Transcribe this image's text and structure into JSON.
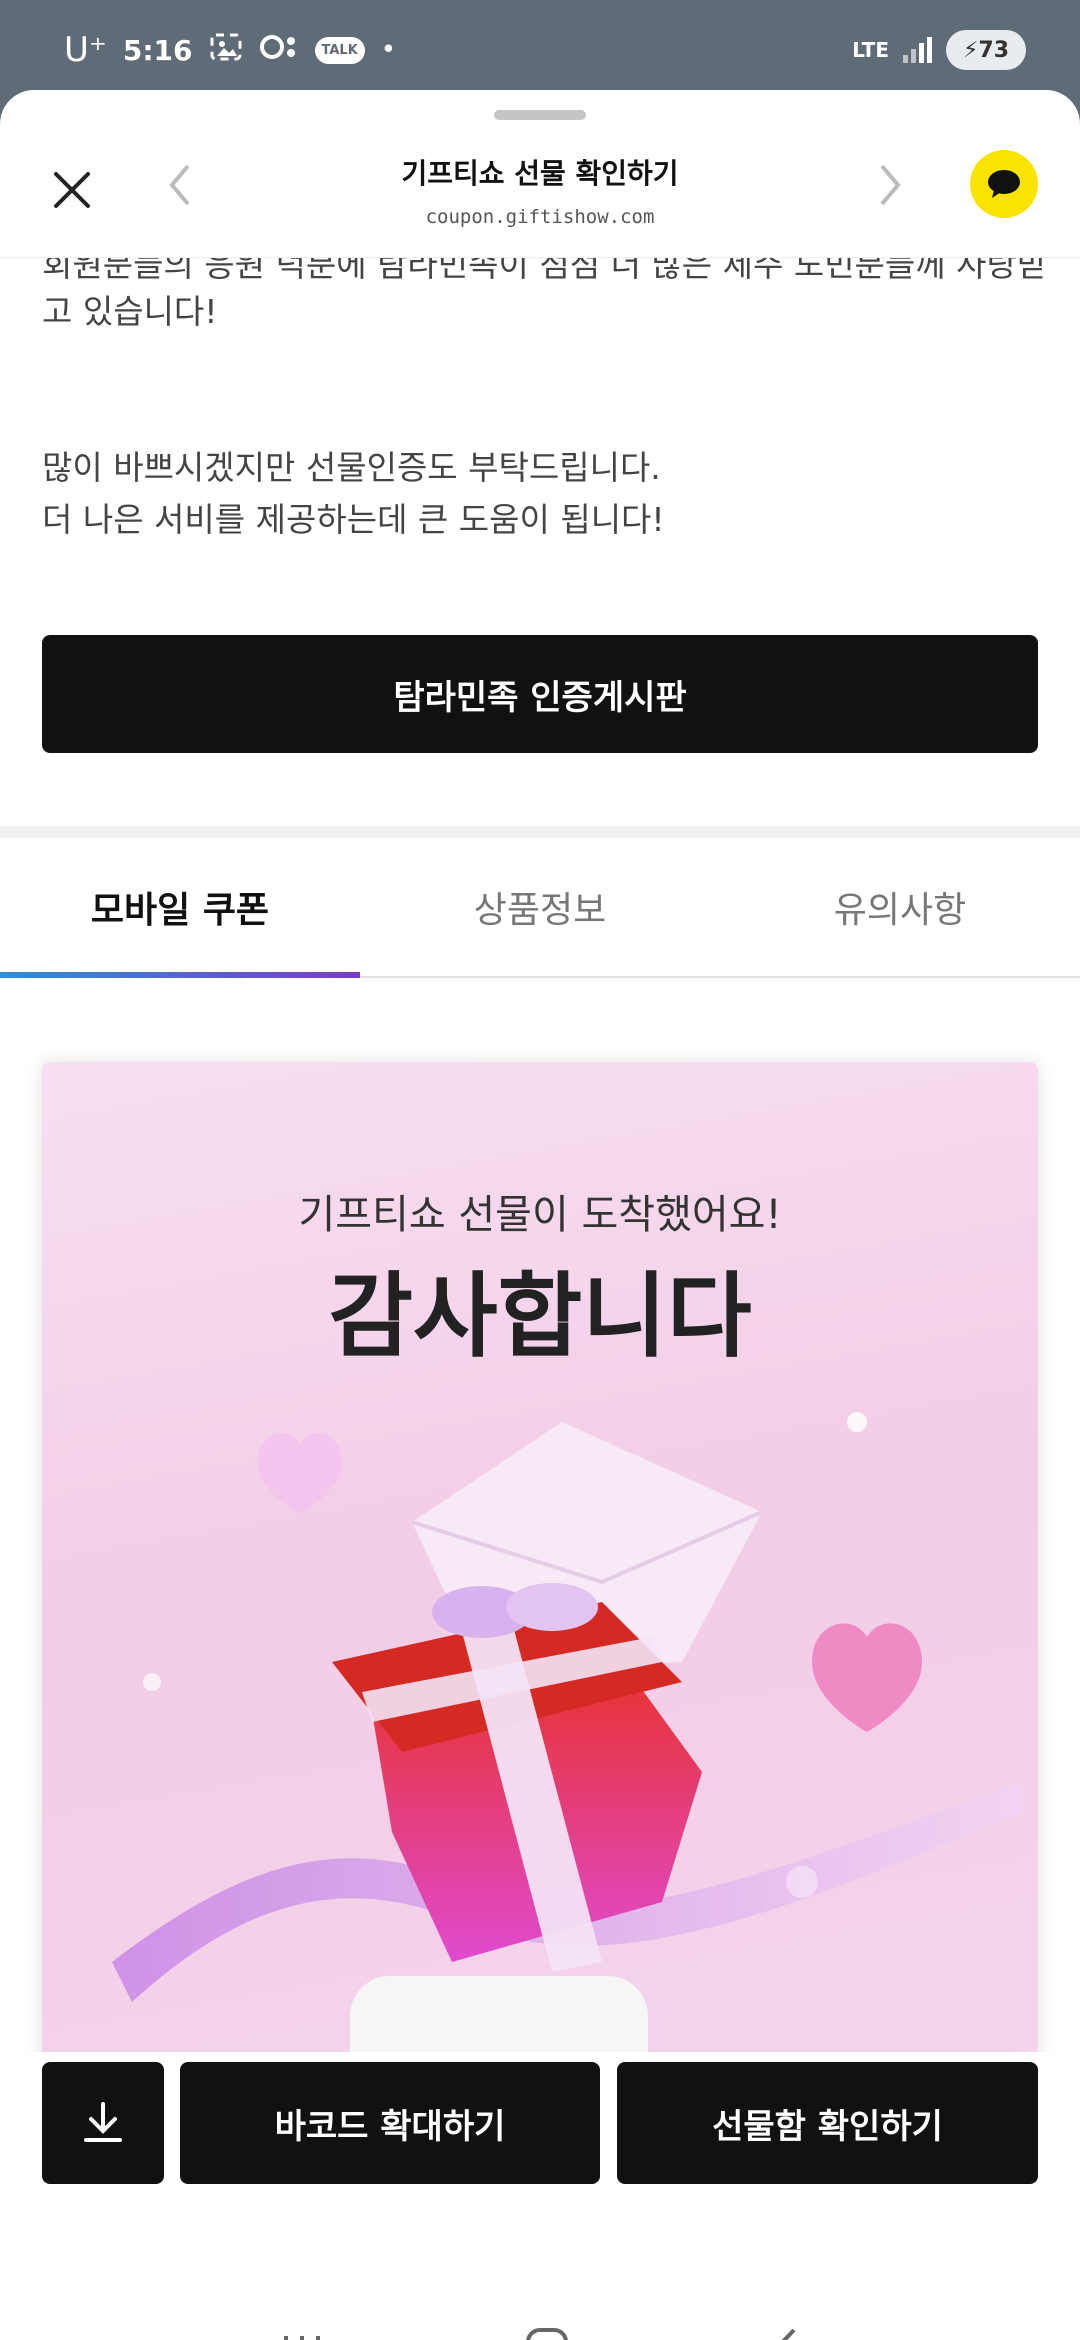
{
  "status_bar": {
    "carrier": "U⁺",
    "time": "5:16",
    "talk": "TALK",
    "network": "LTE",
    "battery": "73"
  },
  "topbar": {
    "title": "기프티쇼 선물 확인하기",
    "url": "coupon.giftishow.com"
  },
  "content": {
    "cut_line": "회원분들의 응원 덕분에 탐라민족이 점점 더 많은 제주 도민분들께 사랑받",
    "line2": "고 있습니다!",
    "line3": "많이 바쁘시겠지만 선물인증도 부탁드립니다.",
    "line4": "더 나은 서비를 제공하는데 큰 도움이 됩니다!",
    "board_button": "탐라민족 인증게시판"
  },
  "tabs": [
    {
      "label": "모바일 쿠폰",
      "active": true
    },
    {
      "label": "상품정보",
      "active": false
    },
    {
      "label": "유의사항",
      "active": false
    }
  ],
  "card": {
    "subtitle": "기프티쇼 선물이 도착했어요!",
    "title": "감사합니다"
  },
  "actions": {
    "download_icon": "download-icon",
    "barcode": "바코드 확대하기",
    "giftbox": "선물함 확인하기"
  },
  "colors": {
    "status_bg": "#5f6b77",
    "kakao_yellow": "#fbe300",
    "button_black": "#111111",
    "tab_gradient_start": "#2f8fd8",
    "tab_gradient_end": "#7a3cc6"
  }
}
